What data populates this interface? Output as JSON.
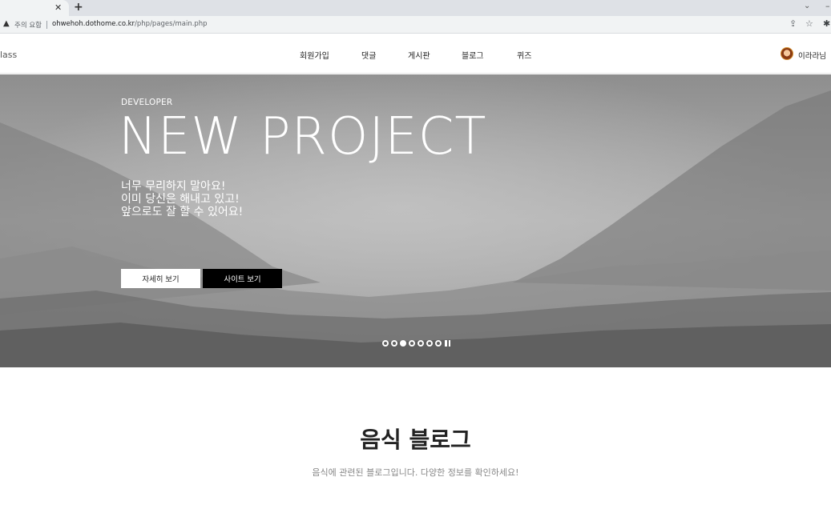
{
  "browser": {
    "tab_close_icon": "close-icon",
    "new_tab_icon": "plus-icon",
    "security_warning": "주의 요함",
    "url_host": "ohwehoh.dothome.co.kr",
    "url_path": "/php/pages/main.php"
  },
  "header": {
    "logo": "lass",
    "nav": [
      "회원가입",
      "댓글",
      "게시판",
      "블로그",
      "퀴즈"
    ],
    "user_name": "이라라님"
  },
  "hero": {
    "eyebrow": "DEVELOPER",
    "title": "NEW PROJECT",
    "description": [
      "너무 무리하지 말아요!",
      "이미 당신은 해내고 있고!",
      "앞으로도 잘 할 수 있어요!"
    ],
    "button_detail": "자세히 보기",
    "button_site": "사이트 보기",
    "slide_count": 7,
    "active_slide": 3
  },
  "section": {
    "title": "음식 블로그",
    "subtitle": "음식에 관련된 블로그입니다. 다양한 정보를 확인하세요!"
  },
  "colors": {
    "button_dark": "#000000",
    "button_light": "#ffffff",
    "hero_tone": "#8f8f8f"
  }
}
